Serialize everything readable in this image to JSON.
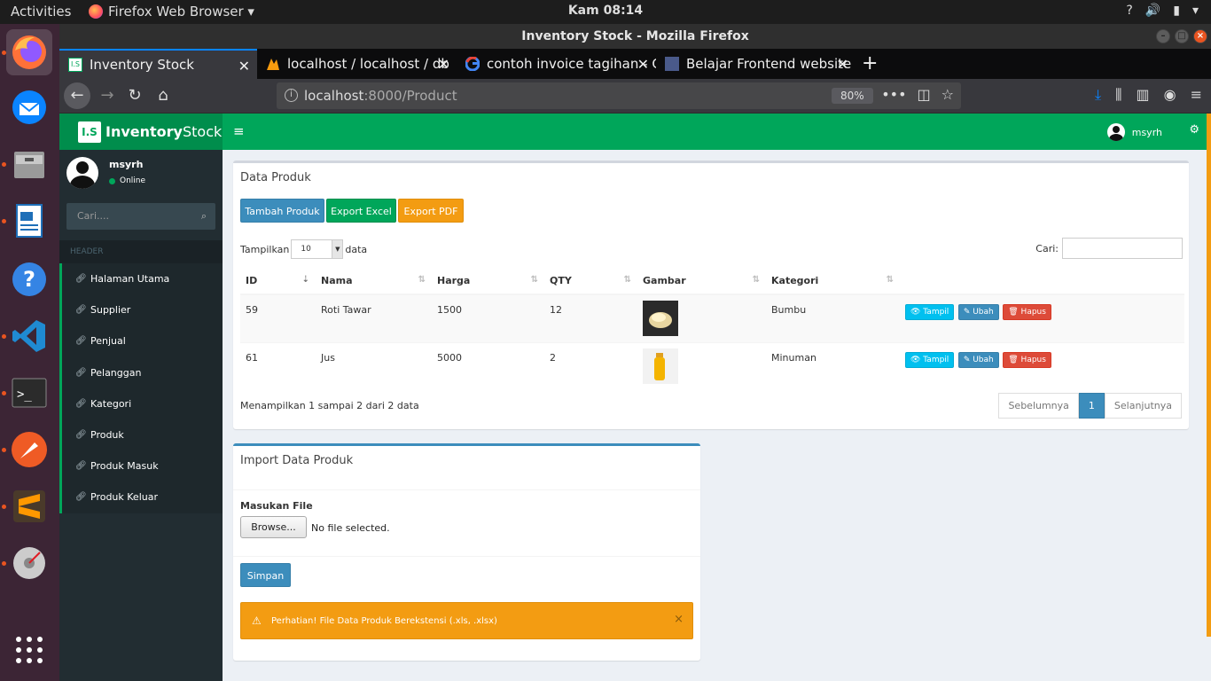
{
  "system": {
    "activities": "Activities",
    "app_menu": "Firefox Web Browser ▾",
    "clock": "Kam 08:14",
    "icons": [
      "help-icon",
      "volume-icon",
      "battery-icon",
      "menu-arrow-icon"
    ]
  },
  "dock": {
    "apps": [
      "firefox",
      "thunderbird",
      "files",
      "libreoffice-writer",
      "help",
      "vscode",
      "terminal",
      "postman",
      "sublime",
      "disk-utility"
    ],
    "grid_icon": "show-apps-icon"
  },
  "window": {
    "title": "Inventory Stock - Mozilla Firefox"
  },
  "tabs": [
    {
      "label": "Inventory Stock",
      "active": true
    },
    {
      "label": "localhost / localhost / db"
    },
    {
      "label": "contoh invoice tagihan - G"
    },
    {
      "label": "Belajar Frontend website"
    }
  ],
  "urlbar": {
    "host": "localhost",
    "path": ":8000/Product",
    "zoom": "80%"
  },
  "app": {
    "logo_box": "I.S",
    "logo_bold": "Inventory",
    "logo_rest": "Stock",
    "user": "msyrh",
    "status": "Online",
    "search_placeholder": "Cari....",
    "menu_header": "HEADER",
    "menu": [
      "Halaman Utama",
      "Supplier",
      "Penjual",
      "Pelanggan",
      "Kategori",
      "Produk",
      "Produk Masuk",
      "Produk Keluar"
    ]
  },
  "products_box": {
    "title": "Data Produk",
    "buttons": {
      "add": "Tambah Produk",
      "excel": "Export Excel",
      "pdf": "Export PDF"
    },
    "length_prefix": "Tampilkan",
    "length_value": "10",
    "length_suffix": "data",
    "search_label": "Cari:",
    "columns": [
      "ID",
      "Nama",
      "Harga",
      "QTY",
      "Gambar",
      "Kategori",
      ""
    ],
    "rows": [
      {
        "id": "59",
        "nama": "Roti Tawar",
        "harga": "1500",
        "qty": "12",
        "kategori": "Bumbu"
      },
      {
        "id": "61",
        "nama": "Jus",
        "harga": "5000",
        "qty": "2",
        "kategori": "Minuman"
      }
    ],
    "actions": {
      "view": "Tampil",
      "edit": "Ubah",
      "delete": "Hapus"
    },
    "info": "Menampilkan 1 sampai 2 dari 2 data",
    "pager": {
      "prev": "Sebelumnya",
      "page": "1",
      "next": "Selanjutnya"
    }
  },
  "import_box": {
    "title": "Import Data Produk",
    "file_label": "Masukan File",
    "browse": "Browse...",
    "no_file": "No file selected.",
    "save": "Simpan",
    "alert": "Perhatian!  File Data Produk Berekstensi (.xls, .xlsx)"
  },
  "colors": {
    "green": "#00a65a",
    "sidebar": "#222d32",
    "primary": "#3c8dbc",
    "warning": "#f39c12",
    "danger": "#dd4b39",
    "info": "#00c0ef"
  }
}
